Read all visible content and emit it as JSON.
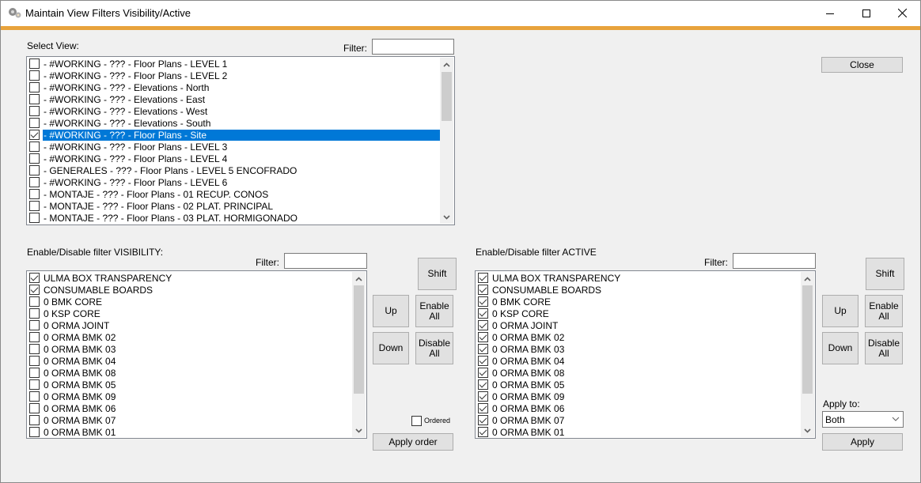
{
  "window": {
    "title": "Maintain View Filters Visibility/Active",
    "icon": "gears-icon",
    "controls": [
      "minimize-icon",
      "maximize-icon",
      "close-icon"
    ],
    "accent_color": "#e8a33c"
  },
  "select_view": {
    "label": "Select View:",
    "filter_label": "Filter:",
    "filter_value": "",
    "items": [
      {
        "label": " - #WORKING - ??? - Floor Plans - LEVEL 1",
        "checked": false,
        "selected": false
      },
      {
        "label": " - #WORKING - ??? - Floor Plans - LEVEL 2",
        "checked": false,
        "selected": false
      },
      {
        "label": " - #WORKING - ??? - Elevations - North",
        "checked": false,
        "selected": false
      },
      {
        "label": " - #WORKING - ??? - Elevations - East",
        "checked": false,
        "selected": false
      },
      {
        "label": " - #WORKING - ??? - Elevations - West",
        "checked": false,
        "selected": false
      },
      {
        "label": " - #WORKING - ??? - Elevations - South",
        "checked": false,
        "selected": false
      },
      {
        "label": " - #WORKING - ??? - Floor Plans - Site",
        "checked": true,
        "selected": true
      },
      {
        "label": " - #WORKING - ??? - Floor Plans - LEVEL 3",
        "checked": false,
        "selected": false
      },
      {
        "label": " - #WORKING - ??? - Floor Plans - LEVEL 4",
        "checked": false,
        "selected": false
      },
      {
        "label": " - GENERALES - ??? - Floor Plans - LEVEL 5 ENCOFRADO",
        "checked": false,
        "selected": false
      },
      {
        "label": " - #WORKING - ??? - Floor Plans - LEVEL 6",
        "checked": false,
        "selected": false
      },
      {
        "label": " - MONTAJE - ??? - Floor Plans - 01 RECUP. CONOS",
        "checked": false,
        "selected": false
      },
      {
        "label": " - MONTAJE - ??? - Floor Plans - 02 PLAT. PRINCIPAL",
        "checked": false,
        "selected": false
      },
      {
        "label": " - MONTAJE - ??? - Floor Plans - 03 PLAT. HORMIGONADO",
        "checked": false,
        "selected": false
      }
    ]
  },
  "close_button": "Close",
  "visibility": {
    "label": "Enable/Disable filter VISIBILITY:",
    "filter_label": "Filter:",
    "filter_value": "",
    "items": [
      {
        "label": "ULMA BOX TRANSPARENCY",
        "checked": true
      },
      {
        "label": "CONSUMABLE BOARDS",
        "checked": true
      },
      {
        "label": "0 BMK CORE",
        "checked": false
      },
      {
        "label": "0 KSP CORE",
        "checked": false
      },
      {
        "label": "0 ORMA JOINT",
        "checked": false
      },
      {
        "label": "0 ORMA BMK 02",
        "checked": false
      },
      {
        "label": "0 ORMA BMK 03",
        "checked": false
      },
      {
        "label": "0 ORMA BMK 04",
        "checked": false
      },
      {
        "label": "0 ORMA BMK 08",
        "checked": false
      },
      {
        "label": "0 ORMA BMK 05",
        "checked": false
      },
      {
        "label": "0 ORMA BMK 09",
        "checked": false
      },
      {
        "label": "0 ORMA BMK 06",
        "checked": false
      },
      {
        "label": "0 ORMA BMK 07",
        "checked": false
      },
      {
        "label": "0 ORMA BMK 01",
        "checked": false
      }
    ],
    "buttons": {
      "shift": "Shift",
      "up": "Up",
      "down": "Down",
      "enable_all": "Enable All",
      "disable_all": "Disable All",
      "apply_order": "Apply order"
    },
    "ordered_label": "Ordered",
    "ordered_checked": false
  },
  "active": {
    "label": "Enable/Disable filter ACTIVE",
    "filter_label": "Filter:",
    "filter_value": "",
    "items": [
      {
        "label": "ULMA BOX TRANSPARENCY",
        "checked": true
      },
      {
        "label": "CONSUMABLE BOARDS",
        "checked": true
      },
      {
        "label": "0 BMK CORE",
        "checked": true
      },
      {
        "label": "0 KSP CORE",
        "checked": true
      },
      {
        "label": "0 ORMA JOINT",
        "checked": true
      },
      {
        "label": "0 ORMA BMK 02",
        "checked": true
      },
      {
        "label": "0 ORMA BMK 03",
        "checked": true
      },
      {
        "label": "0 ORMA BMK 04",
        "checked": true
      },
      {
        "label": "0 ORMA BMK 08",
        "checked": true
      },
      {
        "label": "0 ORMA BMK 05",
        "checked": true
      },
      {
        "label": "0 ORMA BMK 09",
        "checked": true
      },
      {
        "label": "0 ORMA BMK 06",
        "checked": true
      },
      {
        "label": "0 ORMA BMK 07",
        "checked": true
      },
      {
        "label": "0 ORMA BMK 01",
        "checked": true
      }
    ],
    "buttons": {
      "shift": "Shift",
      "up": "Up",
      "down": "Down",
      "enable_all": "Enable All",
      "disable_all": "Disable All"
    },
    "apply_to_label": "Apply to:",
    "apply_to_value": "Both",
    "apply_button": "Apply"
  }
}
